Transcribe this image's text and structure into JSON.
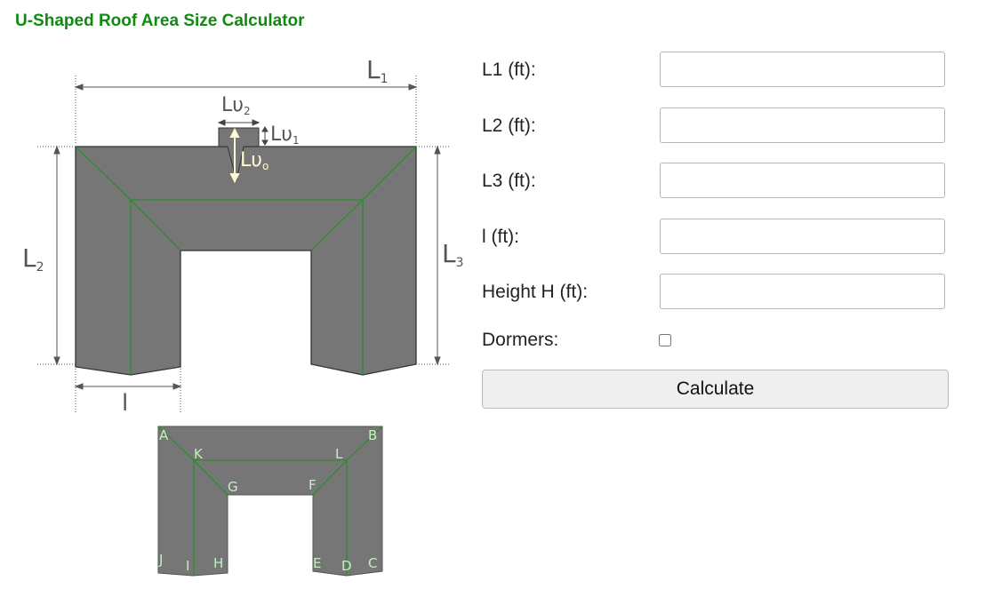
{
  "page": {
    "title": "U-Shaped Roof Area Size Calculator"
  },
  "diagram": {
    "labels": {
      "L1": "L",
      "L1_sub": "1",
      "L2": "L",
      "L2_sub": "2",
      "L3": "L",
      "L3_sub": "3",
      "l": "l",
      "Lw2": "Lυ",
      "Lw2_sub": "2",
      "Lw1": "Lυ",
      "Lw1_sub": "1",
      "Lw0": "Lυ",
      "Lw0_sub": "o"
    },
    "points": [
      "A",
      "B",
      "K",
      "L",
      "G",
      "F",
      "J",
      "I",
      "H",
      "E",
      "D",
      "C"
    ]
  },
  "form": {
    "fields": [
      {
        "label": "L1 (ft):",
        "value": ""
      },
      {
        "label": "L2 (ft):",
        "value": ""
      },
      {
        "label": "L3 (ft):",
        "value": ""
      },
      {
        "label": "l (ft):",
        "value": ""
      },
      {
        "label": "Height H (ft):",
        "value": ""
      }
    ],
    "dormers_label": "Dormers:",
    "dormers_checked": false,
    "calculate_label": "Calculate"
  },
  "colors": {
    "title": "#108a10",
    "roof_fill": "#767676",
    "ridge_line": "#1f8f1f",
    "point_label": "#bff2bf"
  }
}
